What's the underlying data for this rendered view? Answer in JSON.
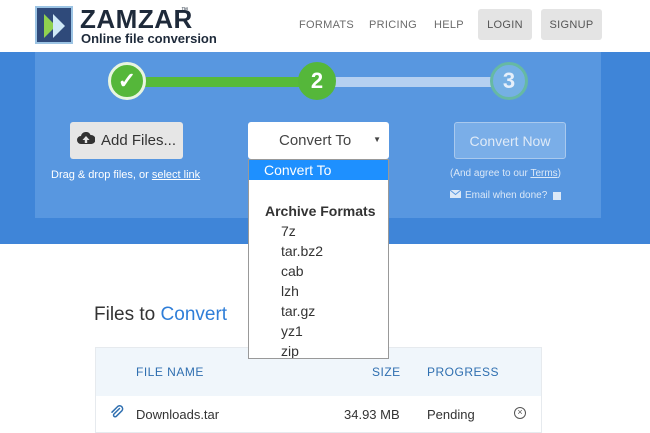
{
  "brand": {
    "name": "ZAMZAR",
    "tm": "™",
    "tagline": "Online file conversion"
  },
  "nav": {
    "formats": "FORMATS",
    "pricing": "PRICING",
    "help": "HELP",
    "login": "LOGIN",
    "signup": "SIGNUP"
  },
  "steps": {
    "step1": "✓",
    "step2": "2",
    "step3": "3"
  },
  "controls": {
    "add_files": "Add Files...",
    "drag_text": "Drag & drop files, or ",
    "select_link": "select link",
    "convert_to": "Convert To",
    "caret": "▼",
    "convert_now": "Convert Now",
    "agree_text": "(And agree to our ",
    "terms_link": "Terms",
    "agree_close": ")",
    "email_text": "Email when done?"
  },
  "dropdown": {
    "selected": "Convert To",
    "group": "Archive Formats",
    "options": [
      "7z",
      "tar.bz2",
      "cab",
      "lzh",
      "tar.gz",
      "yz1",
      "zip"
    ]
  },
  "files": {
    "title_prefix": "Files to ",
    "title_highlight": "Convert",
    "headers": {
      "file_name": "FILE NAME",
      "size": "SIZE",
      "progress": "PROGRESS"
    },
    "rows": [
      {
        "name": "Downloads.tar",
        "size": "34.93 MB",
        "progress": "Pending"
      }
    ]
  },
  "colors": {
    "band": "#3f85d8",
    "panel": "#5897e0",
    "step_green": "#55b73a",
    "dropdown_highlight": "#1e90ff",
    "accent": "#2f7ed8"
  }
}
